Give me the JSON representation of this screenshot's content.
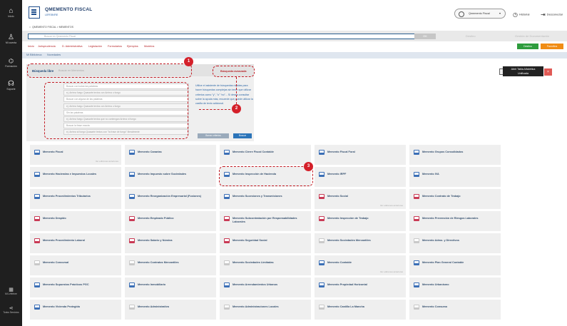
{
  "sidebar": {
    "items": [
      {
        "icon": "home-icon",
        "glyph": "⌂",
        "label": "Inicio"
      },
      {
        "icon": "user-icon",
        "glyph": "♙",
        "label": "Mi cuenta"
      },
      {
        "icon": "graduation-icon",
        "glyph": "🎓",
        "label": "Formación"
      },
      {
        "icon": "headset-icon",
        "glyph": "☊",
        "label": "Soporte"
      }
    ],
    "bottom": [
      {
        "icon": "building-icon",
        "glyph": "▦",
        "label": "Mi Lefebvre"
      },
      {
        "icon": "share-icon",
        "glyph": "⋖",
        "label": "Todos Servicios"
      }
    ]
  },
  "header": {
    "logo_title": "QMEMENTO FISCAL",
    "logo_sub": "LEFEBVRE",
    "breadcrumb": "QMEMENTO FISCAL > MEMENTOS",
    "memento_select": "Qmemento Fiscal",
    "links": [
      {
        "icon": "history-icon",
        "glyph": "◷",
        "label": "Historial"
      },
      {
        "icon": "logout-icon",
        "glyph": "⇥",
        "label": "Desconectar"
      }
    ]
  },
  "search": {
    "placeholder": "Buscar en Qmemento Fiscal",
    "button": "OK",
    "link_1": "Destino",
    "link_2": "Gestión de Documentación"
  },
  "nav": {
    "items": [
      "Inicio",
      "Jurisprudencia",
      "D. Administrativa",
      "Legislación",
      "Formularios",
      "Ejemplos",
      "Modelos"
    ],
    "destino": "Destino",
    "favoritos": "Favoritos"
  },
  "tabs": [
    "Mi Biblioteca",
    "Novedades"
  ],
  "panel": {
    "label": "Búsqueda libre",
    "input_placeholder": "Buscar en Mementos",
    "advanced": "Búsqueda avanzada",
    "fields": [
      "Buscar con todas las palabras",
      "ej. Arrima fuego Quasarte textos con Arrima o fuego",
      "Buscar con alguna de las palabras",
      "ej. Arrima fuego Quasarte textos con Arrima o fuego",
      "Sin las palabras",
      "ej. Arrima fuego Quasarte textos que no contengan Arrima ni fuego",
      "Buscar la frase exacta",
      "ej. Arrima al fuego Quasarte textos con \"la frase de fuego\" literalmente"
    ],
    "help": "Utilice el asistente de búsquedas rápidas para hacer búsquedas complejas sin tener que utilizar criterios como \"y\", \"o\" \"no\"... Si desea consultar sobre la ayuda más, recuerde que puede utilizar la casilla de texto adicional.",
    "clear": "Borrar criterios",
    "submit": "Buscar"
  },
  "alpha": {
    "tip_line1": "Abrir Tabla Alfabética",
    "tip_line2": "Unificada",
    "close": "×"
  },
  "annotations": [
    "1",
    "2",
    "3"
  ],
  "colors": {
    "blue": "#3b6fb6",
    "red": "#c93a55",
    "grey": "#c9c9c9",
    "accent_red": "#c31b24"
  },
  "cards": [
    {
      "title": "Memento Fiscal",
      "color": "blue",
      "sub": "Ver ediciones anteriores"
    },
    {
      "title": "Memento Canarias",
      "color": "blue",
      "sub": ""
    },
    {
      "title": "Memento Cierre Fiscal Contable",
      "color": "blue",
      "sub": ""
    },
    {
      "title": "Memento Fiscal Foral",
      "color": "blue",
      "sub": ""
    },
    {
      "title": "Memento Grupos Consolidados",
      "color": "blue",
      "sub": ""
    },
    {
      "title": "Memento Haciendas e Impuestos Locales",
      "color": "blue",
      "sub": ""
    },
    {
      "title": "Memento Impuesto sobre Sociedades",
      "color": "blue",
      "sub": ""
    },
    {
      "title": "Memento Inspección de Hacienda",
      "color": "blue",
      "sub": ""
    },
    {
      "title": "Memento IRPF",
      "color": "blue",
      "sub": ""
    },
    {
      "title": "Memento IVA",
      "color": "blue",
      "sub": ""
    },
    {
      "title": "Memento Procedimientos Tributarios",
      "color": "blue",
      "sub": ""
    },
    {
      "title": "Memento Reorganización Empresarial (Fusiones)",
      "color": "blue",
      "sub": ""
    },
    {
      "title": "Memento Sucesiones y Transmisiones",
      "color": "blue",
      "sub": ""
    },
    {
      "title": "Memento Social",
      "color": "red",
      "sub": "Ver ediciones anteriores"
    },
    {
      "title": "Memento Contrato de Trabajo",
      "color": "red",
      "sub": ""
    },
    {
      "title": "Memento Despido",
      "color": "red",
      "sub": ""
    },
    {
      "title": "Memento Empleado Público",
      "color": "red",
      "sub": ""
    },
    {
      "title": "Memento Subcontratación por Responsabilidades Laborales",
      "color": "red",
      "sub": ""
    },
    {
      "title": "Memento Inspección de Trabajo",
      "color": "red",
      "sub": ""
    },
    {
      "title": "Memento Prevención de Riesgos Laborales",
      "color": "red",
      "sub": ""
    },
    {
      "title": "Memento Procedimiento Laboral",
      "color": "red",
      "sub": ""
    },
    {
      "title": "Memento Salario y Nómina",
      "color": "red",
      "sub": ""
    },
    {
      "title": "Memento Seguridad Social",
      "color": "red",
      "sub": ""
    },
    {
      "title": "Memento Sociedades Mercantiles",
      "color": "grey",
      "sub": ""
    },
    {
      "title": "Memento Admo. y Directivos",
      "color": "grey",
      "sub": ""
    },
    {
      "title": "Memento Concursal",
      "color": "grey",
      "sub": ""
    },
    {
      "title": "Memento Contratos Mercantiles",
      "color": "grey",
      "sub": ""
    },
    {
      "title": "Memento Sociedades Limitadas",
      "color": "grey",
      "sub": ""
    },
    {
      "title": "Memento Contable",
      "color": "blue",
      "sub": "Ver ediciones anteriores"
    },
    {
      "title": "Memento Plan General Contable",
      "color": "blue",
      "sub": ""
    },
    {
      "title": "Memento Supuestos Prácticos PGC",
      "color": "blue",
      "sub": ""
    },
    {
      "title": "Memento Inmobiliario",
      "color": "blue",
      "sub": ""
    },
    {
      "title": "Memento Arrendamientos Urbanos",
      "color": "blue",
      "sub": ""
    },
    {
      "title": "Memento Propiedad Horizontal",
      "color": "blue",
      "sub": ""
    },
    {
      "title": "Memento Urbanismo",
      "color": "blue",
      "sub": ""
    },
    {
      "title": "Memento Vivienda Protegida",
      "color": "blue",
      "sub": ""
    },
    {
      "title": "Memento Administrativo",
      "color": "grey",
      "sub": ""
    },
    {
      "title": "Memento Administraciones Locales",
      "color": "grey",
      "sub": ""
    },
    {
      "title": "Memento Castilla La Mancha",
      "color": "grey",
      "sub": ""
    },
    {
      "title": "Memento Consumo",
      "color": "grey",
      "sub": ""
    }
  ]
}
